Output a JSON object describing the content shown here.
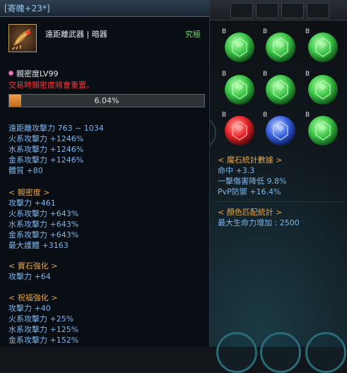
{
  "title": "[寄魄+23*]",
  "item": {
    "icon": "dragon-claw-weapon-icon",
    "type": "遠距離武器 | 暗器",
    "grade": "究極",
    "intimacy_label": "親密度LV99",
    "intimacy_warning": "交易時親密度將會重置。",
    "progress_text": "6.04%",
    "progress_value": 0.0604
  },
  "base_stats": [
    "遠距離攻擊力 763 ~ 1034",
    "火系攻擊力 +1246%",
    "水系攻擊力 +1246%",
    "金系攻擊力 +1246%",
    "體質 +80"
  ],
  "intimacy_section": {
    "header": "< 親密度 >",
    "lines": [
      "攻擊力 +461",
      "火系攻擊力 +643%",
      "水系攻擊力 +643%",
      "金系攻擊力 +643%",
      "最大護體 +3163"
    ]
  },
  "gem_enhance": {
    "header": "< 寶石強化 >",
    "lines": [
      "攻擊力 +64"
    ]
  },
  "blessing_enhance": {
    "header": "< 祝福強化 >",
    "lines": [
      "攻擊力 +40",
      "火系攻擊力 +25%",
      "水系攻擊力 +125%",
      "金系攻擊力 +152%"
    ]
  },
  "gems": [
    {
      "label": "B",
      "color": "green"
    },
    {
      "label": "B",
      "color": "green"
    },
    {
      "label": "B",
      "color": "green"
    },
    {
      "label": "B",
      "color": "green"
    },
    {
      "label": "B",
      "color": "green"
    },
    {
      "label": "B",
      "color": "green"
    },
    {
      "label": "B",
      "color": "red"
    },
    {
      "label": "B",
      "color": "blue"
    },
    {
      "label": "B",
      "color": "green"
    }
  ],
  "magic_stone": {
    "header": "< 魔石統計數據 >",
    "lines": [
      "命中 +3.3",
      "一擊傷害降低 9.8%",
      "PvP防禦 +16.4%"
    ]
  },
  "color_match": {
    "header": "< 顏色匹配統計 >",
    "lines": [
      "最大生命力增加 : 2500"
    ]
  },
  "colors": {
    "green": "#3ec64a",
    "red": "#e8242a",
    "blue": "#3a62e0",
    "stat_text": "#7eb6ea",
    "header_text": "#e7a54a",
    "warning": "#ff3434",
    "grade": "#6fd36f"
  }
}
